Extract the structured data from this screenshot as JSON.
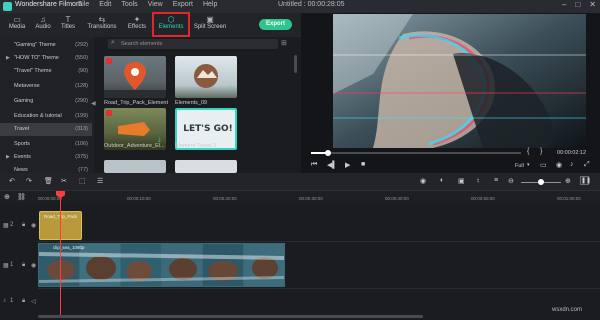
{
  "titlebar": {
    "app_name": "Wondershare Filmora",
    "menu": [
      "File",
      "Edit",
      "Tools",
      "View",
      "Export",
      "Help"
    ],
    "doc_title": "Untitled : 00:00:28:05",
    "window_controls": [
      "minimize-icon",
      "maximize-icon",
      "close-icon"
    ]
  },
  "tabs": [
    {
      "label": "Media",
      "icon": "folder-icon"
    },
    {
      "label": "Audio",
      "icon": "music-note-icon"
    },
    {
      "label": "Titles",
      "icon": "text-icon"
    },
    {
      "label": "Transitions",
      "icon": "transition-icon"
    },
    {
      "label": "Effects",
      "icon": "effects-icon"
    },
    {
      "label": "Elements",
      "icon": "elements-icon",
      "active": true
    },
    {
      "label": "Split Screen",
      "icon": "split-screen-icon"
    }
  ],
  "export_label": "Export",
  "sidebar": {
    "items": [
      {
        "label": "\"Gaming\" Theme",
        "count": "(292)"
      },
      {
        "label": "\"HOW TO\" Theme",
        "count": "(550)",
        "expandable": true
      },
      {
        "label": "\"Travel\" Theme",
        "count": "(90)"
      },
      {
        "label": "Metaverse",
        "count": "(128)"
      },
      {
        "label": "Gaming",
        "count": "(290)"
      },
      {
        "label": "Education & tutorial",
        "count": "(199)"
      },
      {
        "label": "Travel",
        "count": "(313)",
        "selected": true
      },
      {
        "label": "Sports",
        "count": "(106)"
      },
      {
        "label": "Events",
        "count": "(375)",
        "expandable": true
      },
      {
        "label": "News",
        "count": "(77)"
      }
    ]
  },
  "search": {
    "placeholder": "Search elements"
  },
  "library": {
    "items": [
      {
        "label": "Road_Trip_Pack_Element"
      },
      {
        "label": "Elements_09"
      },
      {
        "label": "Outdoor_Adventure_El..."
      },
      {
        "label": "Element Travel 3"
      }
    ],
    "travel_text": "LET'S GO!"
  },
  "preview": {
    "timecode": "00:00:02:12",
    "quality": "Full",
    "progress_fraction": 0.08
  },
  "ruler": {
    "ticks": [
      "00:00:00:00",
      "00:00:10:00",
      "00:00:20:00",
      "00:00:30:00",
      "00:00:40:00",
      "00:00:50:00",
      "00:01:00:00",
      "00:01:10:00"
    ]
  },
  "timeline": {
    "element_clip_label": "Road_Trip_Pack",
    "video_clip_label": "clip_sea_1080p",
    "track_numbers": [
      "2",
      "1",
      "1"
    ]
  },
  "watermark": "wsxdn.com",
  "colors": {
    "accent": "#2fd6c4",
    "export": "#2fc58f",
    "highlight": "#e0262e",
    "playhead": "#ff3b3b"
  }
}
